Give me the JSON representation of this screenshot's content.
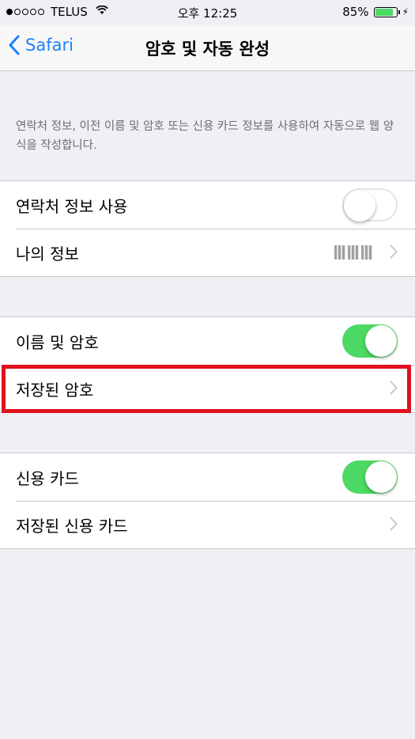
{
  "status_bar": {
    "carrier": "TELUS",
    "time": "오후 12:25",
    "battery": "85%",
    "battery_level": 0.85,
    "signal_icon": "signal-dots-icon",
    "wifi_icon": "wifi-icon",
    "charging_icon": "bolt-icon"
  },
  "nav": {
    "back_label": "Safari",
    "title": "암호 및 자동 완성"
  },
  "description": "연락처 정보, 이전 이름 및 암호 또는 신용 카드 정보를 사용하여 자동으로 웹 양식을 작성합니다.",
  "groups": [
    {
      "rows": [
        {
          "label": "연락처 정보 사용",
          "control": "toggle",
          "on": false
        },
        {
          "label": "나의 정보",
          "control": "chevron",
          "value_obscured": true
        }
      ]
    },
    {
      "rows": [
        {
          "label": "이름 및 암호",
          "control": "toggle",
          "on": true
        },
        {
          "label": "저장된 암호",
          "control": "chevron",
          "highlighted": true
        }
      ]
    },
    {
      "rows": [
        {
          "label": "신용 카드",
          "control": "toggle",
          "on": true
        },
        {
          "label": "저장된 신용 카드",
          "control": "chevron"
        }
      ]
    }
  ],
  "colors": {
    "accent": "#1a82fb",
    "toggle_on": "#4cd964",
    "highlight": "#e0111f",
    "background": "#efeff4"
  }
}
